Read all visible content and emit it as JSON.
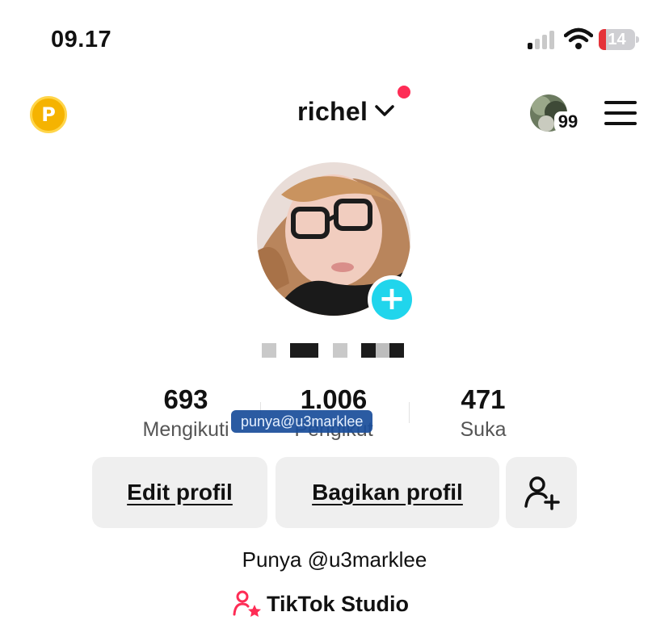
{
  "status_bar": {
    "time": "09.17",
    "battery_level": "14",
    "signal_icon": "cellular-signal-icon",
    "wifi_icon": "wifi-icon"
  },
  "header": {
    "coin_icon_letter": "P",
    "username": "richel",
    "notification_count": "99"
  },
  "profile": {
    "handle_censored": true,
    "bio": "Punya @u3marklee",
    "watermark": "punya@u3marklee"
  },
  "stats": [
    {
      "value": "693",
      "label": "Mengikuti"
    },
    {
      "value": "1.006",
      "label": "Pengikut"
    },
    {
      "value": "471",
      "label": "Suka"
    }
  ],
  "actions": {
    "edit_label": "Edit profil",
    "share_label": "Bagikan profil",
    "add_friend_icon": "add-user-icon"
  },
  "studio": {
    "label": "TikTok Studio",
    "icon": "creator-star-icon"
  },
  "colors": {
    "accent_red": "#fe2c55",
    "plus_cyan": "#20d5ec",
    "coin_gold": "#f5b301",
    "button_gray": "#efefef"
  }
}
